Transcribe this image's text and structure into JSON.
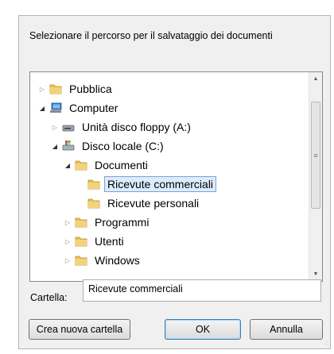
{
  "dialog": {
    "prompt": "Selezionare il percorso per il salvataggio dei documenti",
    "folder_label": "Cartella:",
    "folder_value": "Ricevute commerciali",
    "buttons": {
      "new_folder": "Crea nuova cartella",
      "ok": "OK",
      "cancel": "Annulla"
    }
  },
  "tree": {
    "items": [
      {
        "label": "Pubblica",
        "icon": "folder-icon",
        "expander": "collapsed"
      },
      {
        "label": "Computer",
        "icon": "computer-icon",
        "expander": "expanded"
      },
      {
        "label": "Unità disco floppy (A:)",
        "icon": "floppy-drive-icon",
        "expander": "collapsed"
      },
      {
        "label": "Disco locale (C:)",
        "icon": "local-disk-icon",
        "expander": "expanded"
      },
      {
        "label": "Documenti",
        "icon": "folder-icon",
        "expander": "expanded"
      },
      {
        "label": "Ricevute commerciali",
        "icon": "folder-icon",
        "expander": "none",
        "selected": true
      },
      {
        "label": "Ricevute personali",
        "icon": "folder-icon",
        "expander": "none"
      },
      {
        "label": "Programmi",
        "icon": "folder-icon",
        "expander": "collapsed"
      },
      {
        "label": "Utenti",
        "icon": "folder-icon",
        "expander": "collapsed"
      },
      {
        "label": "Windows",
        "icon": "folder-icon",
        "expander": "collapsed"
      }
    ]
  },
  "colors": {
    "dialog_bg": "#f0f0f0",
    "selection_bg": "#dcecfc",
    "selection_border": "#7da2ce",
    "folder": "#e8c15a"
  }
}
